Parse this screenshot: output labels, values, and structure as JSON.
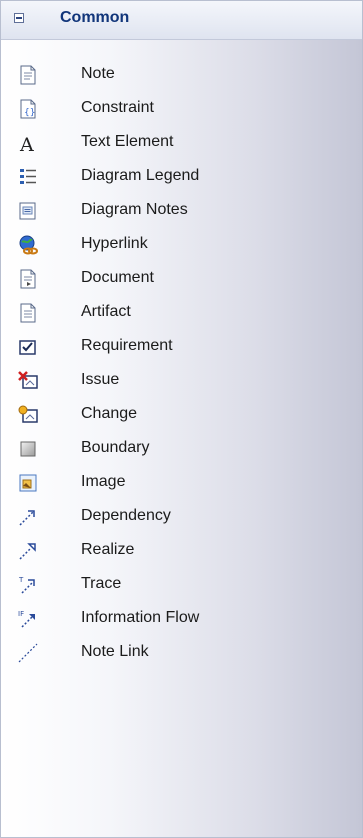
{
  "section": {
    "title": "Common"
  },
  "items": [
    {
      "label": "Note",
      "icon": "note-icon"
    },
    {
      "label": "Constraint",
      "icon": "constraint-icon"
    },
    {
      "label": "Text Element",
      "icon": "text-element-icon"
    },
    {
      "label": "Diagram Legend",
      "icon": "diagram-legend-icon"
    },
    {
      "label": "Diagram Notes",
      "icon": "diagram-notes-icon"
    },
    {
      "label": "Hyperlink",
      "icon": "hyperlink-icon"
    },
    {
      "label": "Document",
      "icon": "document-icon"
    },
    {
      "label": "Artifact",
      "icon": "artifact-icon"
    },
    {
      "label": "Requirement",
      "icon": "requirement-icon"
    },
    {
      "label": "Issue",
      "icon": "issue-icon"
    },
    {
      "label": "Change",
      "icon": "change-icon"
    },
    {
      "label": "Boundary",
      "icon": "boundary-icon"
    },
    {
      "label": "Image",
      "icon": "image-icon"
    },
    {
      "label": "Dependency",
      "icon": "dependency-icon"
    },
    {
      "label": "Realize",
      "icon": "realize-icon"
    },
    {
      "label": "Trace",
      "icon": "trace-icon"
    },
    {
      "label": "Information Flow",
      "icon": "information-flow-icon"
    },
    {
      "label": "Note Link",
      "icon": "note-link-icon"
    }
  ]
}
